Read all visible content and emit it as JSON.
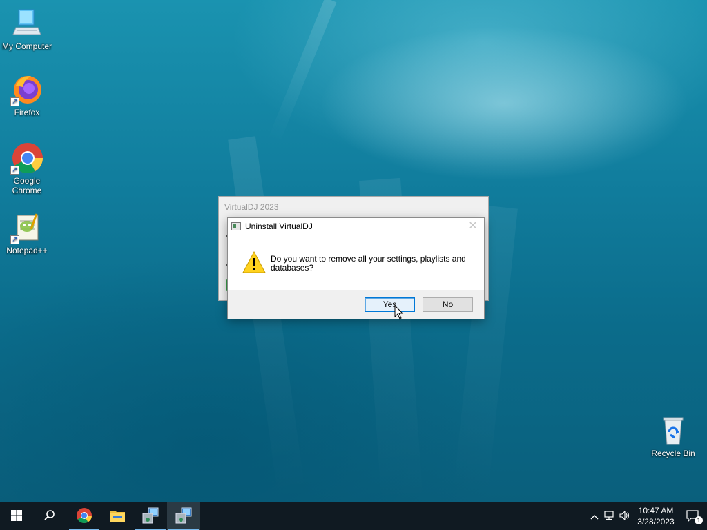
{
  "desktop": {
    "icons": [
      {
        "label": "My Computer",
        "icon": "computer-icon"
      },
      {
        "label": "Firefox",
        "icon": "firefox-icon"
      },
      {
        "label": "Google Chrome",
        "icon": "chrome-icon"
      },
      {
        "label": "Notepad++",
        "icon": "notepadpp-icon"
      },
      {
        "label": "Recycle Bin",
        "icon": "recycle-bin-icon"
      }
    ]
  },
  "background_window": {
    "title": "VirtualDJ 2023"
  },
  "dialog": {
    "title": "Uninstall VirtualDJ",
    "close_symbol": "✕",
    "message": "Do you want to remove all your settings, playlists and databases?",
    "yes_label": "Yes",
    "no_label": "No",
    "icon": "warning-icon"
  },
  "taskbar": {
    "items": [
      {
        "name": "start",
        "icon": "windows-start-icon"
      },
      {
        "name": "search",
        "icon": "search-icon"
      },
      {
        "name": "chrome",
        "icon": "chrome-icon"
      },
      {
        "name": "file-explorer",
        "icon": "folder-icon"
      },
      {
        "name": "installer",
        "icon": "installer-icon"
      },
      {
        "name": "installer-active",
        "icon": "installer-icon"
      }
    ],
    "clock": {
      "time": "10:47 AM",
      "date": "3/28/2023"
    },
    "notification_count": "1"
  },
  "colors": {
    "accent": "#0078d7",
    "taskbar": "#101a22"
  }
}
